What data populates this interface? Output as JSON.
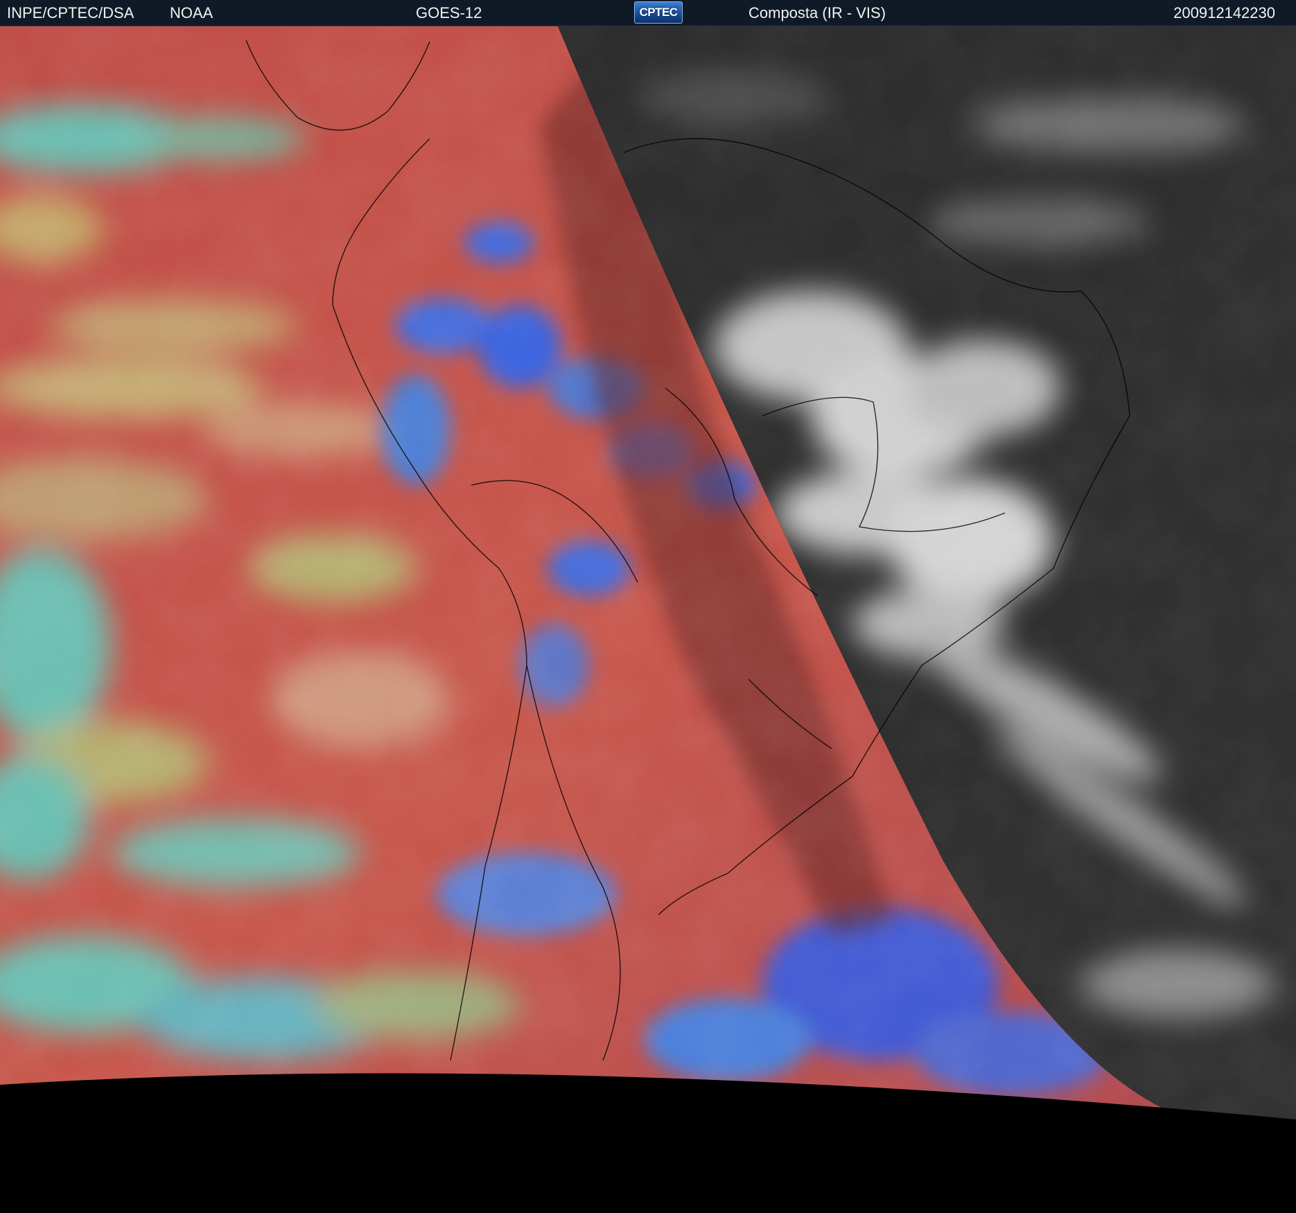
{
  "header": {
    "organization": "INPE/CPTEC/DSA",
    "agency": "NOAA",
    "satellite": "GOES-12",
    "logo_text": "CPTEC",
    "product": "Composta (IR - VIS)",
    "timestamp": "200912142230"
  },
  "colors": {
    "header_background": "#0f1a26",
    "header_text": "#f2f2f2",
    "ir_composite_base": "#c4504a",
    "cold_cloud_tops": "#3f6fe8",
    "mid_cloud": "#5fd6c8",
    "low_cloud": "#b8c47a",
    "visible_ocean": "#2e2e2e",
    "visible_cloud": "#e8e8e8",
    "space_background": "#000000",
    "border_lines": "#000000"
  },
  "icons": {
    "logo": "cptec-logo"
  }
}
